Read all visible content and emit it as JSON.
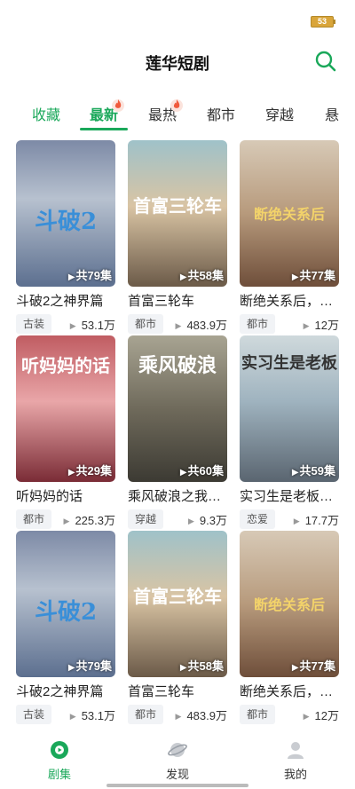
{
  "status": {
    "battery": "53"
  },
  "header": {
    "title": "莲华短剧"
  },
  "tabs": [
    {
      "label": "收藏"
    },
    {
      "label": "最新"
    },
    {
      "label": "最热"
    },
    {
      "label": "都市"
    },
    {
      "label": "穿越"
    },
    {
      "label": "悬"
    }
  ],
  "dramas": [
    {
      "title": "斗破2之神界篇",
      "poster_text": "斗破2",
      "episodes": "共79集",
      "tag": "古装",
      "views": "53.1万"
    },
    {
      "title": "首富三轮车",
      "poster_text": "首富三轮车",
      "episodes": "共58集",
      "tag": "都市",
      "views": "483.9万"
    },
    {
      "title": "断绝关系后，…",
      "poster_text": "断绝关系后",
      "episodes": "共77集",
      "tag": "都市",
      "views": "12万"
    },
    {
      "title": "听妈妈的话",
      "poster_text": "听妈妈的话",
      "episodes": "共29集",
      "tag": "都市",
      "views": "225.3万"
    },
    {
      "title": "乘风破浪之我…",
      "poster_text": "乘风破浪",
      "episodes": "共60集",
      "tag": "穿越",
      "views": "9.3万"
    },
    {
      "title": "实习生是老板…",
      "poster_text": "实习生是老板",
      "episodes": "共59集",
      "tag": "恋爱",
      "views": "17.7万"
    },
    {
      "title": "斗破2之神界篇",
      "poster_text": "斗破2",
      "episodes": "共79集",
      "tag": "古装",
      "views": "53.1万"
    },
    {
      "title": "首富三轮车",
      "poster_text": "首富三轮车",
      "episodes": "共58集",
      "tag": "都市",
      "views": "483.9万"
    },
    {
      "title": "断绝关系后，…",
      "poster_text": "断绝关系后",
      "episodes": "共77集",
      "tag": "都市",
      "views": "12万"
    }
  ],
  "bottom_nav": [
    {
      "label": "剧集",
      "icon": "play-circle-icon"
    },
    {
      "label": "发现",
      "icon": "planet-icon"
    },
    {
      "label": "我的",
      "icon": "user-icon"
    }
  ],
  "colors": {
    "accent": "#1aa85a",
    "flame": "#f05a3c"
  }
}
